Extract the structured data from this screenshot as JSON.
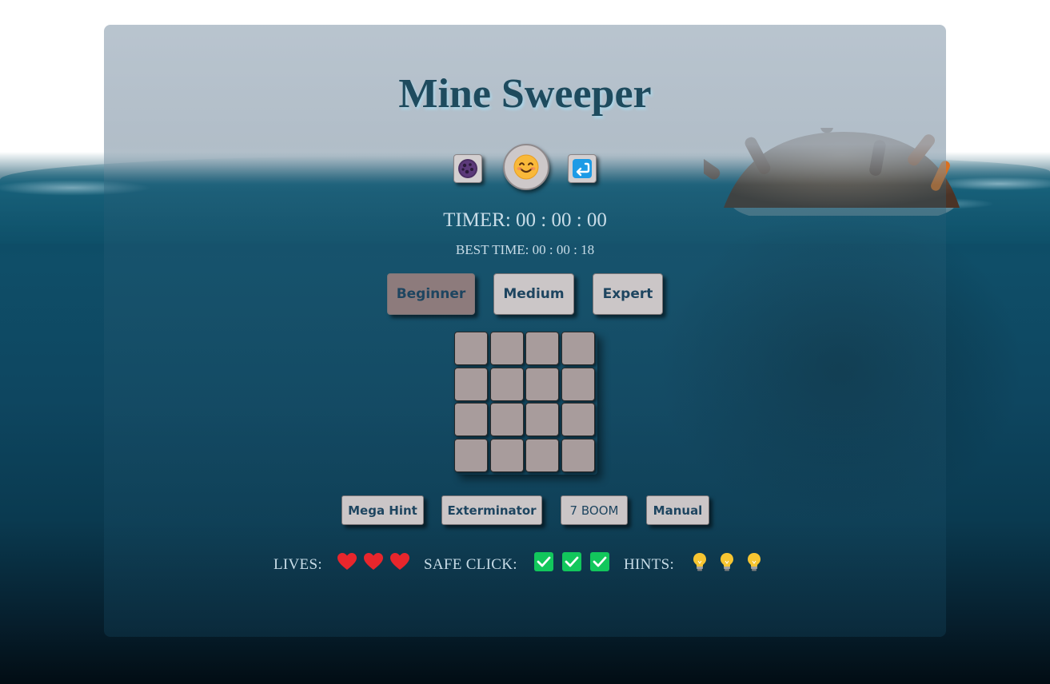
{
  "title": "Mine Sweeper",
  "controls": {
    "bomb_icon": "bomb-icon",
    "smiley_icon": "smiling-face-icon",
    "undo_icon": "undo-arrow-icon"
  },
  "timer": {
    "text": "TIMER: 00 : 00 : 00"
  },
  "best_time": {
    "text": "BEST TIME: 00 : 00 : 18"
  },
  "levels": {
    "beginner": "Beginner",
    "medium": "Medium",
    "expert": "Expert",
    "selected": "Beginner"
  },
  "board": {
    "rows": 4,
    "cols": 4,
    "cell_state": "hidden"
  },
  "tools": {
    "mega_hint": "Mega Hint",
    "exterminator": "Exterminator",
    "seven_boom": "7 BOOM",
    "manual": "Manual"
  },
  "status": {
    "lives_label": "LIVES:",
    "lives_count": 3,
    "lives_icon": "heart-icon",
    "safe_click_label": "SAFE CLICK:",
    "safe_click_count": 3,
    "safe_click_icon": "check-mark-icon",
    "hints_label": "HINTS:",
    "hints_count": 3,
    "hints_icon": "light-bulb-icon"
  },
  "colors": {
    "title": "#1e4b5e",
    "button_face": "#cbc6c7",
    "selected_level": "#8d7b7c",
    "cell": "#a89c9c",
    "heart": "#e8262c",
    "check": "#12c75c",
    "bulb": "#f7c531"
  }
}
